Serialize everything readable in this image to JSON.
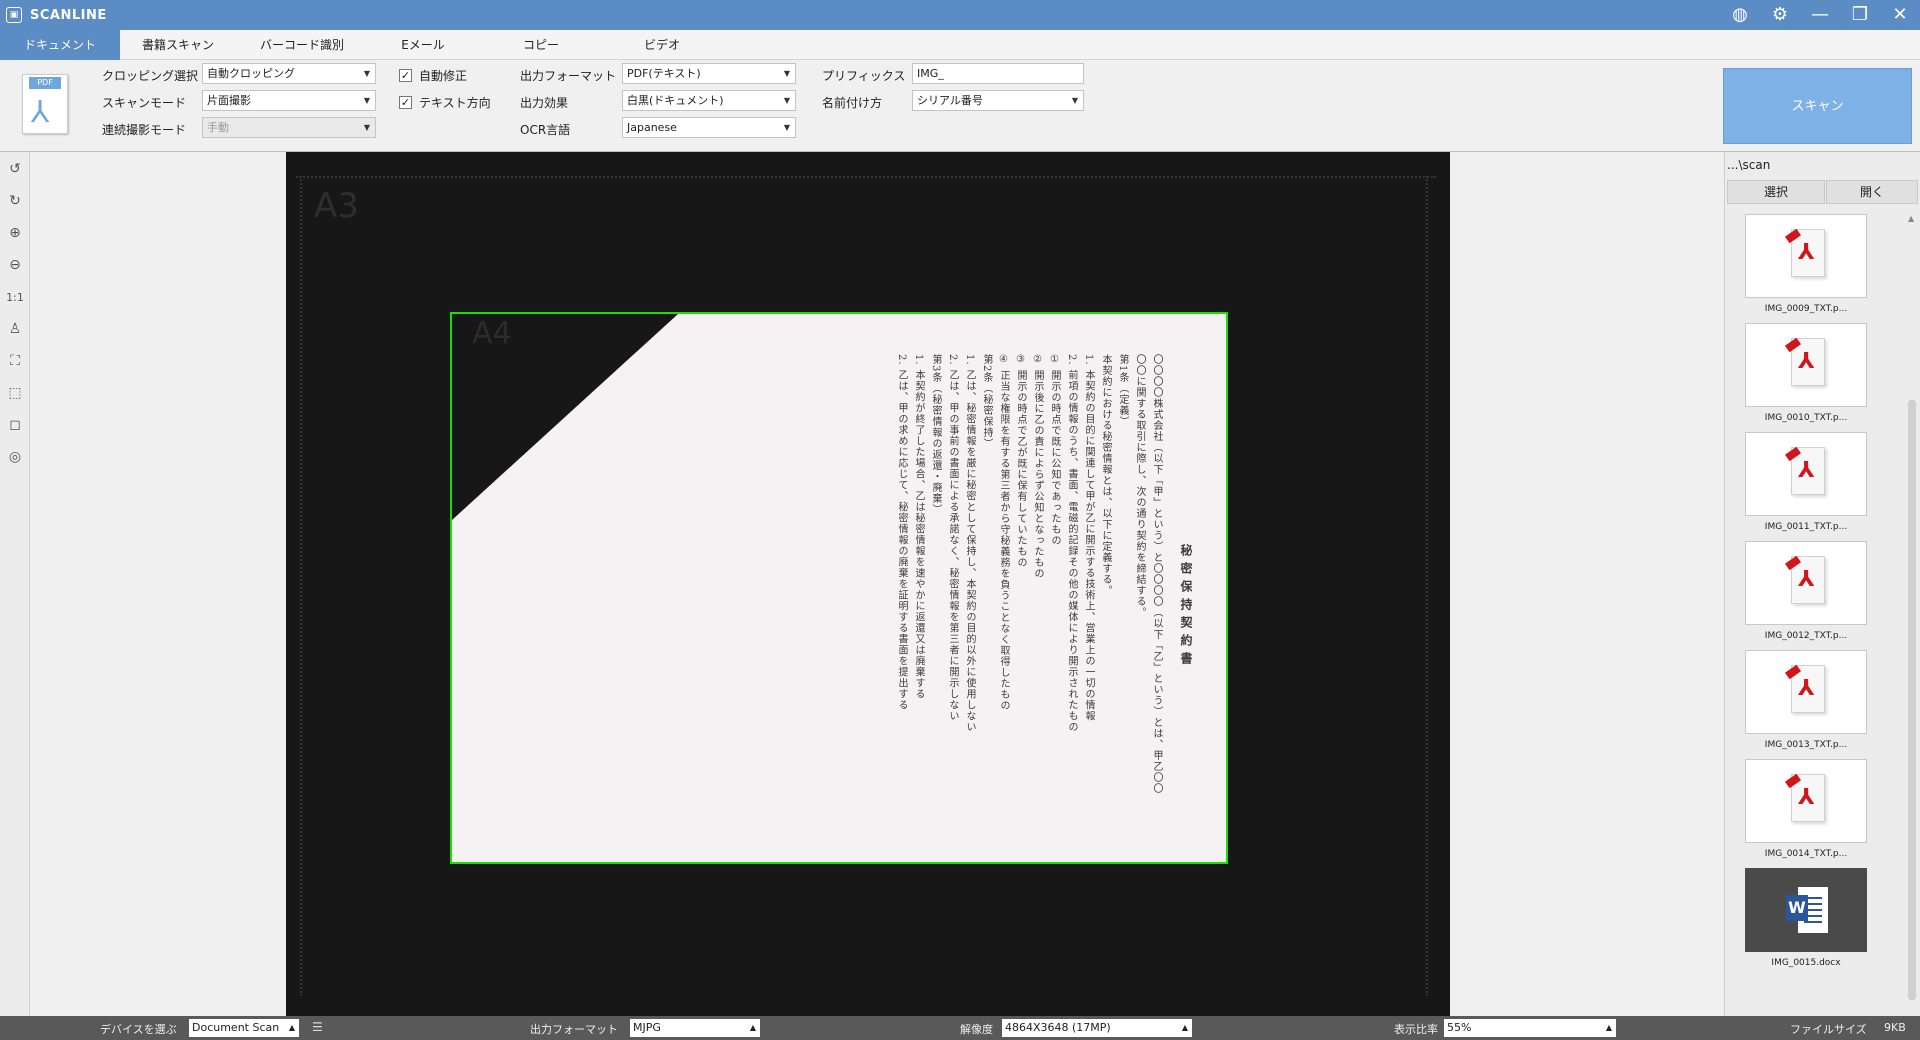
{
  "app": {
    "title": "SCANLINE"
  },
  "window": {
    "controls": [
      "globe-icon",
      "gear-icon",
      "minimize-icon",
      "restore-icon",
      "close-icon"
    ]
  },
  "tabs": [
    {
      "label": "ドキュメント",
      "active": true
    },
    {
      "label": "書籍スキャン"
    },
    {
      "label": "バーコード識別"
    },
    {
      "label": "Eメール"
    },
    {
      "label": "コピー"
    },
    {
      "label": "ビデオ"
    }
  ],
  "toolbar": {
    "format_tile": "PDF",
    "cropping_label": "クロッピング選択",
    "cropping_value": "自動クロッピング",
    "scan_mode_label": "スキャンモード",
    "scan_mode_value": "片面撮影",
    "continuous_label": "連続撮影モード",
    "continuous_value": "手動",
    "auto_correct_label": "自動修正",
    "auto_correct_checked": true,
    "text_direction_label": "テキスト方向",
    "text_direction_checked": true,
    "output_format_label": "出力フォーマット",
    "output_format_value": "PDF(テキスト)",
    "output_effect_label": "出力効果",
    "output_effect_value": "白黒(ドキュメント)",
    "ocr_label": "OCR言語",
    "ocr_value": "Japanese",
    "prefix_label": "プリフィックス",
    "prefix_value": "IMG_",
    "naming_label": "名前付け方",
    "naming_value": "シリアル番号",
    "scan_button": "スキャン"
  },
  "tools": [
    "rotate-left-icon",
    "rotate-right-icon",
    "zoom-in-icon",
    "zoom-out-icon",
    "actual-size-icon",
    "stamp-icon",
    "fit-icon",
    "select-area-icon",
    "crop-icon",
    "settings-circle-icon"
  ],
  "tools_text": {
    "actual_size": "1:1"
  },
  "preview": {
    "label_a3": "A3",
    "label_a4": "A4",
    "doc_title": "秘密保持契約書",
    "doc_lines": [
      "〇〇〇〇株式会社（以下「甲」という）と〇〇〇〇（以下「乙」という）とは、甲乙〇〇",
      "〇〇に関する取引に際し、次の通り契約を締結する。",
      "第1条（定義）",
      "本契約における秘密情報とは、以下に定義する。",
      "1. 本契約の目的に関連して甲が乙に開示する技術上、営業上の一切の情報",
      "2. 前項の情報のうち、書面、電磁的記録その他の媒体により開示されたもの",
      "① 開示の時点で既に公知であったもの",
      "② 開示後に乙の責によらず公知となったもの",
      "③ 開示の時点で乙が既に保有していたもの",
      "④ 正当な権限を有する第三者から守秘義務を負うことなく取得したもの",
      "第2条（秘密保持）",
      "1. 乙は、秘密情報を厳に秘密として保持し、本契約の目的以外に使用しない",
      "2. 乙は、甲の事前の書面による承諾なく、秘密情報を第三者に開示しない",
      "第3条（秘密情報の返還・廃棄）",
      "1. 本契約が終了した場合、乙は秘密情報を速やかに返還又は廃棄する",
      "2. 乙は、甲の求めに応じて、秘密情報の廃棄を証明する書面を提出する"
    ]
  },
  "right_panel": {
    "path": "...\\scan",
    "select_button": "選択",
    "open_button": "開く",
    "thumbnails": [
      {
        "name": "IMG_0009_TXT.p...",
        "kind": "pdf"
      },
      {
        "name": "IMG_0010_TXT.p...",
        "kind": "pdf"
      },
      {
        "name": "IMG_0011_TXT.p...",
        "kind": "pdf"
      },
      {
        "name": "IMG_0012_TXT.p...",
        "kind": "pdf"
      },
      {
        "name": "IMG_0013_TXT.p...",
        "kind": "pdf"
      },
      {
        "name": "IMG_0014_TXT.p...",
        "kind": "pdf"
      },
      {
        "name": "IMG_0015.docx",
        "kind": "word"
      }
    ]
  },
  "status": {
    "device_label": "デバイスを選ぶ",
    "device_value": "Document Scan",
    "format_label": "出力フォーマット",
    "format_value": "MJPG",
    "resolution_label": "解像度",
    "resolution_value": "4864X3648 (17MP)",
    "zoom_label": "表示比率",
    "zoom_value": "55%",
    "filesize_label": "ファイルサイズ",
    "filesize_value": "9KB"
  },
  "colors": {
    "title_bar": "#5b8cc4",
    "scan_button": "#7eb2e6",
    "crop_frame": "#18e000",
    "status_bar": "#595959"
  }
}
